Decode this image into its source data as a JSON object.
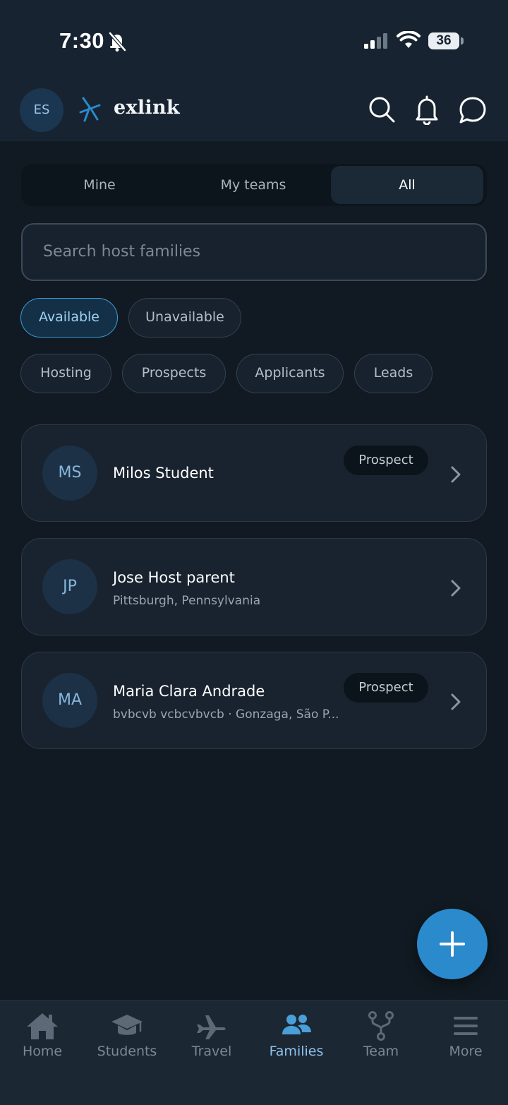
{
  "status_bar": {
    "time": "7:30",
    "battery": "36"
  },
  "header": {
    "avatar_initials": "ES",
    "logo_text": "exlink"
  },
  "segments": [
    {
      "label": "Mine",
      "active": false
    },
    {
      "label": "My teams",
      "active": false
    },
    {
      "label": "All",
      "active": true
    }
  ],
  "search": {
    "placeholder": "Search host families",
    "value": ""
  },
  "availability_filters": [
    {
      "label": "Available",
      "active": true
    },
    {
      "label": "Unavailable",
      "active": false
    }
  ],
  "stage_filters": [
    {
      "label": "Hosting"
    },
    {
      "label": "Prospects"
    },
    {
      "label": "Applicants"
    },
    {
      "label": "Leads"
    }
  ],
  "families": [
    {
      "initials": "MS",
      "name": "Milos Student",
      "subtitle": "",
      "badge": "Prospect"
    },
    {
      "initials": "JP",
      "name": "Jose Host parent",
      "subtitle": "Pittsburgh, Pennsylvania",
      "badge": ""
    },
    {
      "initials": "MA",
      "name": "Maria Clara Andrade",
      "subtitle": "bvbcvb vcbcvbvcb · Gonzaga, São P...",
      "badge": "Prospect"
    }
  ],
  "bottom_nav": [
    {
      "label": "Home",
      "icon": "home-icon",
      "active": false
    },
    {
      "label": "Students",
      "icon": "graduation-cap-icon",
      "active": false
    },
    {
      "label": "Travel",
      "icon": "airplane-icon",
      "active": false
    },
    {
      "label": "Families",
      "icon": "people-icon",
      "active": true
    },
    {
      "label": "Team",
      "icon": "branch-icon",
      "active": false
    },
    {
      "label": "More",
      "icon": "menu-icon",
      "active": false
    }
  ],
  "colors": {
    "accent": "#2a8acc",
    "background": "#111a22",
    "active_nav": "#8fc3ea"
  }
}
